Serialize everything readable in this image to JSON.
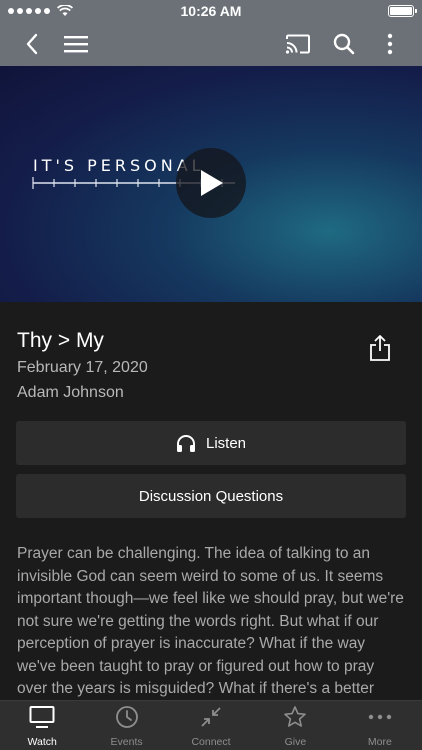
{
  "status_bar": {
    "time": "10:26 AM"
  },
  "video": {
    "title_text": "IT'S PERSONAL"
  },
  "sermon": {
    "title": "Thy > My",
    "date": "February 17, 2020",
    "speaker": "Adam Johnson"
  },
  "buttons": {
    "listen": "Listen",
    "discussion": "Discussion Questions"
  },
  "description": "Prayer can be challenging. The idea of talking to an invisible God can seem weird to some of us. It seems important though—we feel like we should pray, but we're not sure we're getting the words right. But what if our perception of prayer is inaccurate? What if the way we've been taught to pray or figured out how to pray over the years is misguided? What if there's a better way? After watching, Jesus for some time, his",
  "tabs": [
    {
      "label": "Watch",
      "icon": "tv-icon",
      "active": true
    },
    {
      "label": "Events",
      "icon": "clock-icon",
      "active": false
    },
    {
      "label": "Connect",
      "icon": "connect-arrows-icon",
      "active": false
    },
    {
      "label": "Give",
      "icon": "star-icon",
      "active": false
    },
    {
      "label": "More",
      "icon": "more-dots-icon",
      "active": false
    }
  ],
  "colors": {
    "nav_bg": "#6b7177",
    "page_bg": "#1b1b1b",
    "button_bg": "#2c2c2c",
    "tab_bg": "#2f2f2f"
  }
}
